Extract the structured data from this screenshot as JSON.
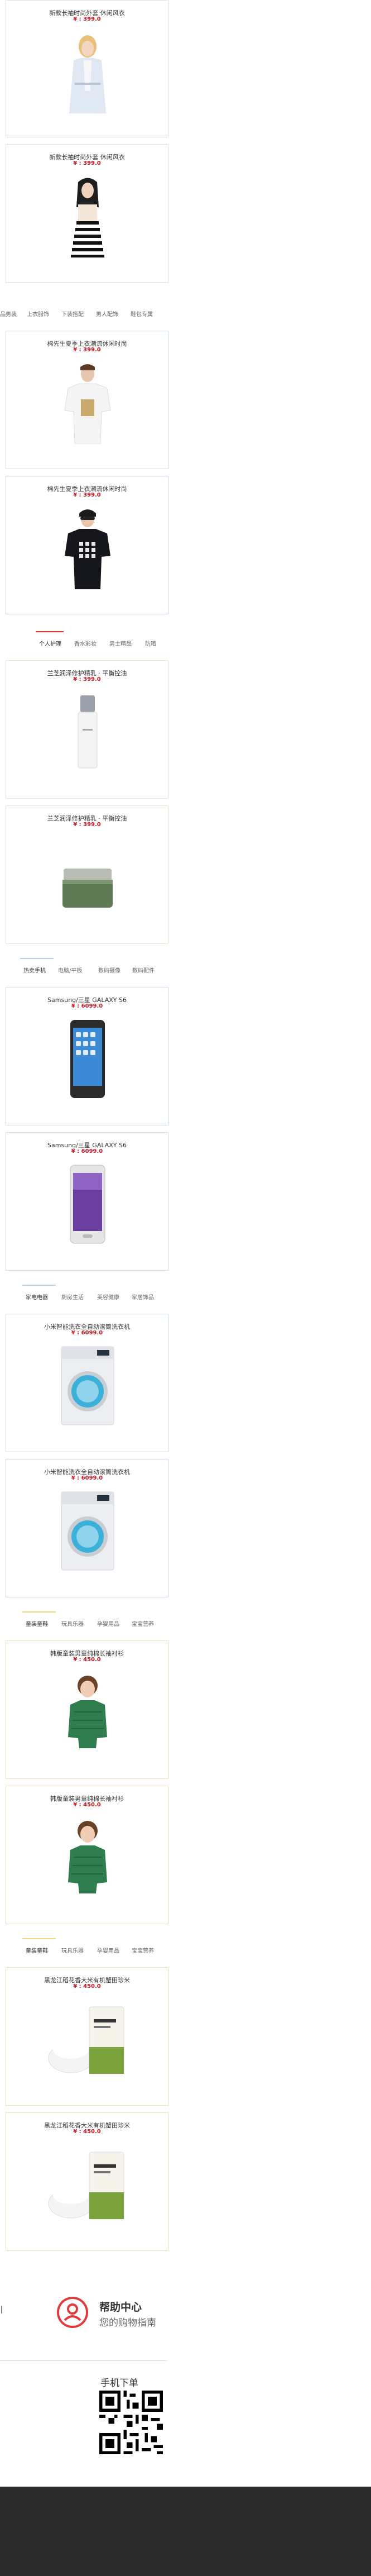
{
  "women": {
    "products": [
      {
        "title": "新款长袖时尚外套 休闲风衣",
        "price": "¥ : 399.0"
      },
      {
        "title": "新款长袖时尚外套 休闲风衣",
        "price": "¥ : 399.0"
      }
    ]
  },
  "men": {
    "tabs": [
      "品男装",
      "上衣服饰",
      "下装搭配",
      "男人配饰",
      "鞋包专属"
    ],
    "products": [
      {
        "title": "棉先生夏季上衣潮流休闲时尚",
        "price": "¥ : 399.0"
      },
      {
        "title": "棉先生夏季上衣潮流休闲时尚",
        "price": "¥ : 399.0"
      }
    ]
  },
  "beauty": {
    "tabs": [
      "个人护理",
      "香水彩妆",
      "男士精品",
      "防晒"
    ],
    "products": [
      {
        "title": "兰芝润泽修护精乳 · 平衡控油",
        "price": "¥ : 399.0"
      },
      {
        "title": "兰芝润泽修护精乳 · 平衡控油",
        "price": "¥ : 399.0"
      }
    ]
  },
  "phones": {
    "tabs": [
      "热卖手机",
      "电脑/平板",
      "数码摄像",
      "数码配件"
    ],
    "products": [
      {
        "title": "Samsung/三星 GALAXY S6",
        "price": "¥ : 6099.0"
      },
      {
        "title": "Samsung/三星 GALAXY S6",
        "price": "¥ : 6099.0"
      }
    ]
  },
  "appliances": {
    "tabs": [
      "家电电器",
      "厨房生活",
      "美容健康",
      "家居饰品"
    ],
    "products": [
      {
        "title": "小米智能洗衣全自动滚筒洗衣机",
        "price": "¥ : 6099.0"
      },
      {
        "title": "小米智能洗衣全自动滚筒洗衣机",
        "price": "¥ : 6099.0"
      }
    ]
  },
  "kids": {
    "tabs": [
      "童装童鞋",
      "玩具乐器",
      "孕婴用品",
      "宝宝营养"
    ],
    "products": [
      {
        "title": "韩版童装男童纯棉长袖衬衫",
        "price": "¥ : 450.0"
      },
      {
        "title": "韩版童装男童纯棉长袖衬衫",
        "price": "¥ : 450.0"
      }
    ]
  },
  "food": {
    "tabs": [
      "童装童鞋",
      "玩具乐器",
      "孕婴用品",
      "宝宝营养"
    ],
    "products": [
      {
        "title": "黑龙江稻花香大米有机蟹田珍米",
        "price": "¥ : 450.0"
      },
      {
        "title": "黑龙江稻花香大米有机蟹田珍米",
        "price": "¥ : 450.0"
      }
    ]
  },
  "footer": {
    "help_title": "帮助中心",
    "help_sub": "您的购物指南",
    "qr_title": "手机下单"
  },
  "colors": {
    "price": "#c81623",
    "accent": "#e4393c",
    "dark_footer": "#2a2a2a"
  }
}
